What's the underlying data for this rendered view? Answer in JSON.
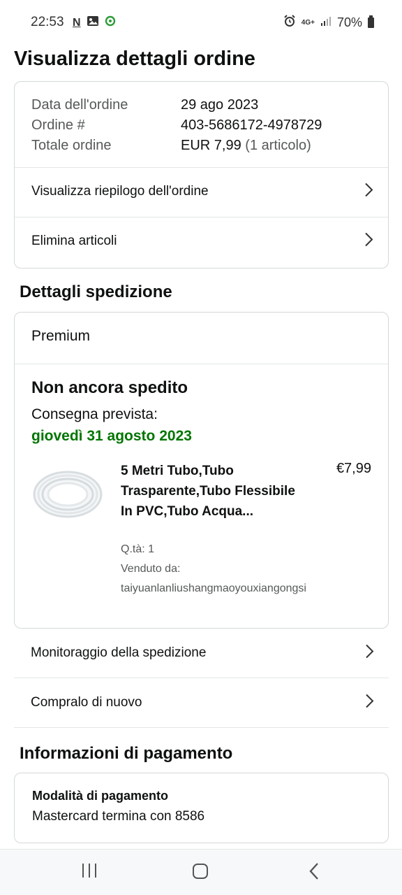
{
  "status_bar": {
    "time": "22:53",
    "left_icons": [
      "N",
      "image-icon",
      "refresh-icon"
    ],
    "network": "4G+",
    "battery": "70%"
  },
  "page": {
    "title": "Visualizza dettagli ordine"
  },
  "summary": {
    "rows": [
      {
        "label": "Data dell'ordine",
        "value": "29 ago 2023"
      },
      {
        "label": "Ordine #",
        "value": "403-5686172-4978729"
      },
      {
        "label": "Totale ordine",
        "value": "EUR 7,99",
        "extra": "(1 articolo)"
      }
    ],
    "links": [
      {
        "label": "Visualizza riepilogo dell'ordine"
      },
      {
        "label": "Elimina articoli"
      }
    ]
  },
  "shipping": {
    "section_title": "Dettagli spedizione",
    "method": "Premium",
    "status": "Non ancora spedito",
    "expected_label": "Consegna prevista:",
    "expected_date": "giovedì 31 agosto 2023",
    "product": {
      "title": "5 Metri Tubo,Tubo Trasparente,Tubo Flessibile In PVC,Tubo Acqua...",
      "price": "€7,99",
      "qty": "Q.tà: 1",
      "sold_by_label": "Venduto da:",
      "seller": "taiyuanlanliushangmaoyouxiangongsi"
    },
    "actions": [
      {
        "label": "Monitoraggio della spedizione"
      },
      {
        "label": "Compralo di nuovo"
      }
    ]
  },
  "payment": {
    "section_title": "Informazioni di pagamento",
    "method_title": "Modalità di pagamento",
    "method_value": "Mastercard  termina con 8586"
  },
  "colors": {
    "delivery_green": "#007600",
    "border": "#d5d9d9"
  }
}
